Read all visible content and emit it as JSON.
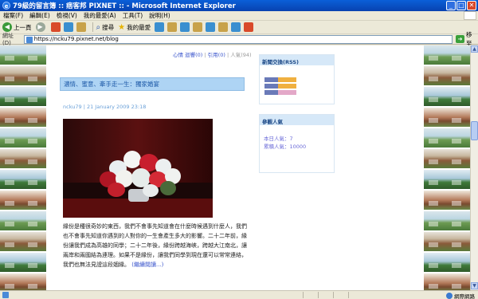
{
  "window": {
    "title": "79級的留言簿 :: 痞客邦 PIXNET :: - Microsoft Internet Explorer",
    "minimize": "_",
    "maximize": "□",
    "close": "✕"
  },
  "menu": [
    "檔案(F)",
    "編輯(E)",
    "檢視(V)",
    "我的最愛(A)",
    "工具(T)",
    "說明(H)"
  ],
  "toolbar": {
    "back_label": "上一頁",
    "search_label": "搜尋",
    "favorites_label": "我的最愛"
  },
  "address": {
    "label": "網址(D)",
    "url": "https://ncku79.pixnet.net/blog",
    "go_label": "移至"
  },
  "blog": {
    "topnav": {
      "heart": "心情",
      "recommend": "迴響(0)",
      "trackback": "引用(0)",
      "views": "人氣(94)"
    },
    "post": {
      "title": "濃情、蜜意、牽手走一生：獨家婚宴",
      "meta": "ncku79 | 21 January 2009 23:18",
      "body": "緣份是種很奇妙的東西，我們不會事先知道會在什麼時候遇到什麼人，我們也不會事先知道你遇到的人對你的一生會產生多大的影響。二十二年前，緣份讓我們成為高雄的同學；二十二年後，緣份跨越海峽，跨越大江南北，讓兩岸和兩國結為連理。如果不是緣份，讓我們同學到現在還可以常常連絡，我們也無法見證這段姻緣。",
      "read_more": "(繼續閱讀...)"
    },
    "widgets": {
      "rss_title": "新聞交換(RSS)",
      "rss_badges": [
        "RSS",
        "RSS",
        "RSS"
      ],
      "visitors_title": "參觀人氣",
      "today": "本日人氣：7",
      "total": "累積人氣：10000"
    }
  },
  "status": {
    "zone_label": "網際網路"
  },
  "colors": {
    "title_bar": "#0842b0",
    "post_header": "#aed4f4",
    "link": "#3a55cc"
  }
}
